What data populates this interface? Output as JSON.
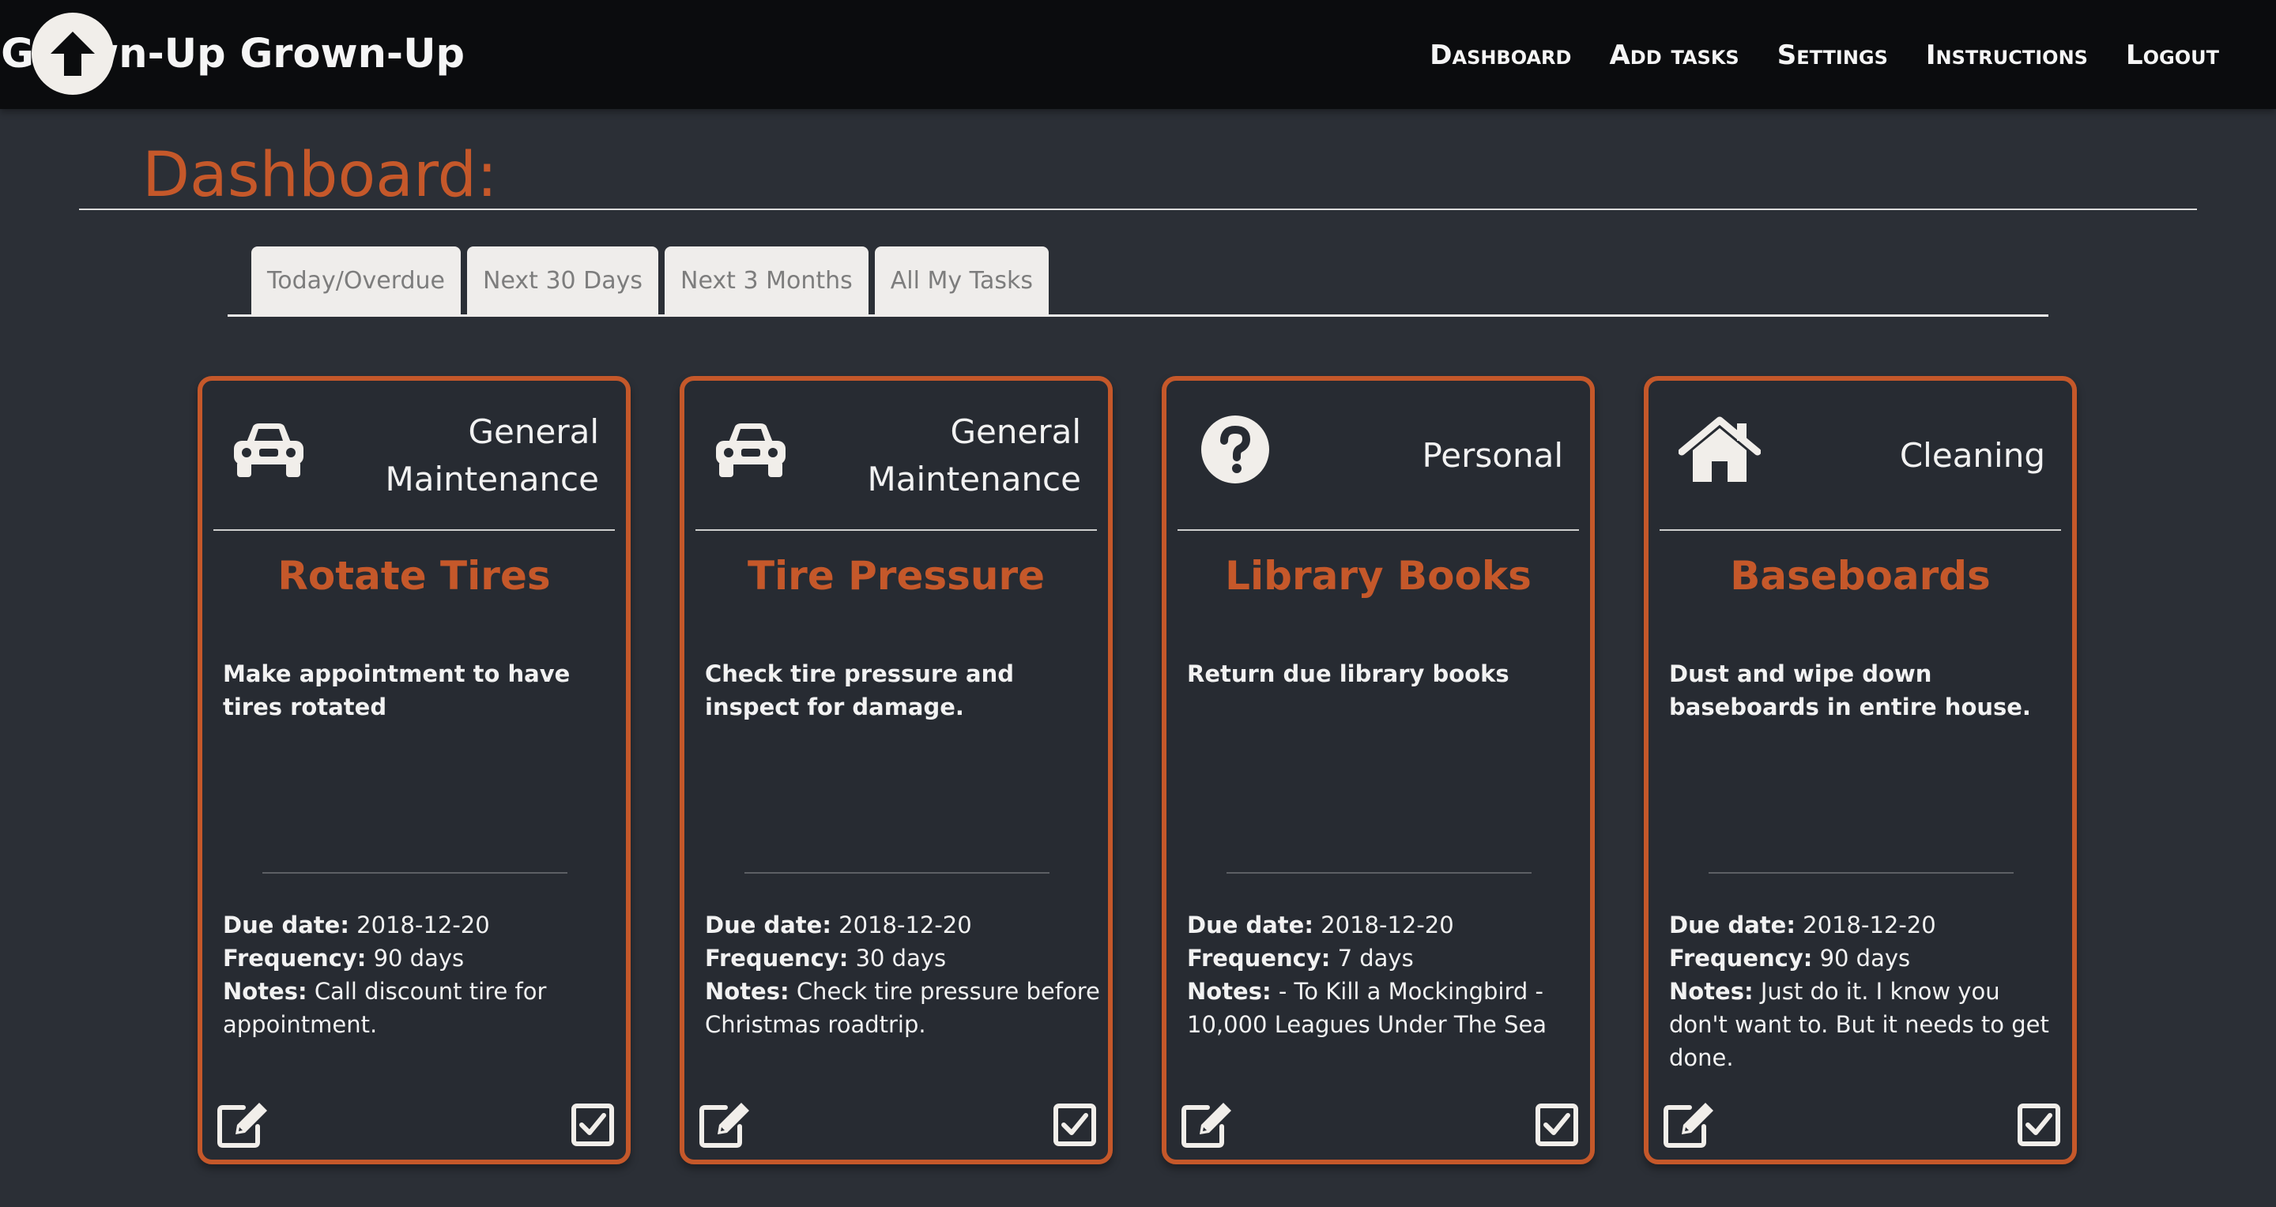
{
  "brand": {
    "name": "Grown-Up Grown-Up",
    "logo_icon": "arrow-up-circle-icon"
  },
  "nav": {
    "items": [
      {
        "label": "Dashboard"
      },
      {
        "label": "Add tasks"
      },
      {
        "label": "Settings"
      },
      {
        "label": "Instructions"
      },
      {
        "label": "Logout"
      }
    ]
  },
  "page": {
    "title": "Dashboard:"
  },
  "tabs": [
    {
      "label": "Today/Overdue"
    },
    {
      "label": "Next 30 Days"
    },
    {
      "label": "Next 3 Months"
    },
    {
      "label": "All My Tasks"
    }
  ],
  "labels": {
    "due_date": "Due date:",
    "frequency": "Frequency:",
    "notes": "Notes:"
  },
  "cards": [
    {
      "icon": "car-icon",
      "category": "General Maintenance",
      "title": "Rotate Tires",
      "description": "Make appointment to have tires rotated",
      "due_date": "2018-12-20",
      "frequency": "90 days",
      "notes": "Call discount tire for appointment."
    },
    {
      "icon": "car-icon",
      "category": "General Maintenance",
      "title": "Tire Pressure",
      "description": "Check tire pressure and inspect for damage.",
      "due_date": "2018-12-20",
      "frequency": "30 days",
      "notes": "Check tire pressure before Christmas roadtrip."
    },
    {
      "icon": "question-circle-icon",
      "category": "Personal",
      "title": "Library Books",
      "description": "Return due library books",
      "due_date": "2018-12-20",
      "frequency": "7 days",
      "notes": "- To Kill a Mockingbird - 10,000 Leagues Under The Sea"
    },
    {
      "icon": "house-icon",
      "category": "Cleaning",
      "title": "Baseboards",
      "description": "Dust and wipe down baseboards in entire house.",
      "due_date": "2018-12-20",
      "frequency": "90 days",
      "notes": "Just do it. I know you don't want to. But it needs to get done."
    }
  ],
  "colors": {
    "accent": "#c5582a",
    "background": "#2b2f36",
    "card_background": "#272b32",
    "navbar": "#0b0c0e"
  }
}
